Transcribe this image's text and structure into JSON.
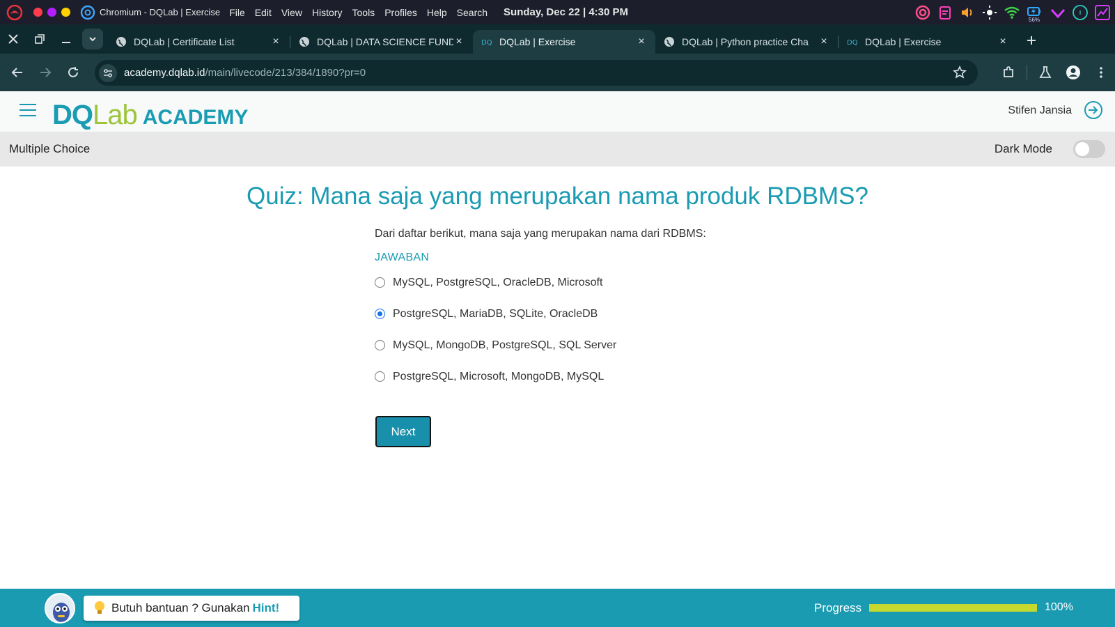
{
  "os": {
    "app_name": "Chromium - DQLab | Exercise",
    "menu": [
      "File",
      "Edit",
      "View",
      "History",
      "Tools",
      "Profiles",
      "Help",
      "Search"
    ],
    "clock": "Sunday, Dec 22 | 4:30 PM",
    "battery_text": "56%",
    "traffic_colors": [
      "#ff3b4e",
      "#b51fff",
      "#ffd200"
    ]
  },
  "tabs": [
    {
      "title": "DQLab | Certificate List",
      "icon": "globe-icon",
      "active": false
    },
    {
      "title": "DQLab | DATA SCIENCE FUND",
      "icon": "globe-icon",
      "active": false
    },
    {
      "title": "DQLab | Exercise",
      "icon": "dqlab-icon",
      "active": true
    },
    {
      "title": "DQLab | Python practice Cha",
      "icon": "globe-icon",
      "active": false
    },
    {
      "title": "DQLab | Exercise",
      "icon": "dqlab-icon",
      "active": false
    }
  ],
  "address": {
    "domain": "academy.dqlab.id",
    "path": "/main/livecode/213/384/1890?pr=0"
  },
  "header": {
    "logo_dq": "DQ",
    "logo_lab": "Lab",
    "logo_academy": "ACADEMY",
    "username": "Stifen Jansia"
  },
  "subheader": {
    "left": "Multiple Choice",
    "dark_mode_label": "Dark Mode",
    "dark_mode_on": false
  },
  "quiz": {
    "title": "Quiz: Mana saja yang merupakan nama produk RDBMS?",
    "question": "Dari daftar berikut, mana saja yang merupakan nama dari RDBMS:",
    "answer_label": "JAWABAN",
    "options": [
      {
        "label": "MySQL, PostgreSQL, OracleDB, Microsoft",
        "selected": false
      },
      {
        "label": "PostgreSQL, MariaDB, SQLite, OracleDB",
        "selected": true
      },
      {
        "label": "MySQL, MongoDB, PostgreSQL, SQL Server",
        "selected": false
      },
      {
        "label": "PostgreSQL, Microsoft, MongoDB, MySQL",
        "selected": false
      }
    ],
    "next_label": "Next"
  },
  "footer": {
    "hint_prefix": "Butuh bantuan ? Gunakan",
    "hint_word": "Hint!",
    "progress_label": "Progress",
    "progress_value": "100%",
    "progress_fraction": 1.0
  },
  "colors": {
    "brand": "#1a9bb2",
    "brand_green": "#9dc43b",
    "progress_fill": "#c6d92f"
  }
}
